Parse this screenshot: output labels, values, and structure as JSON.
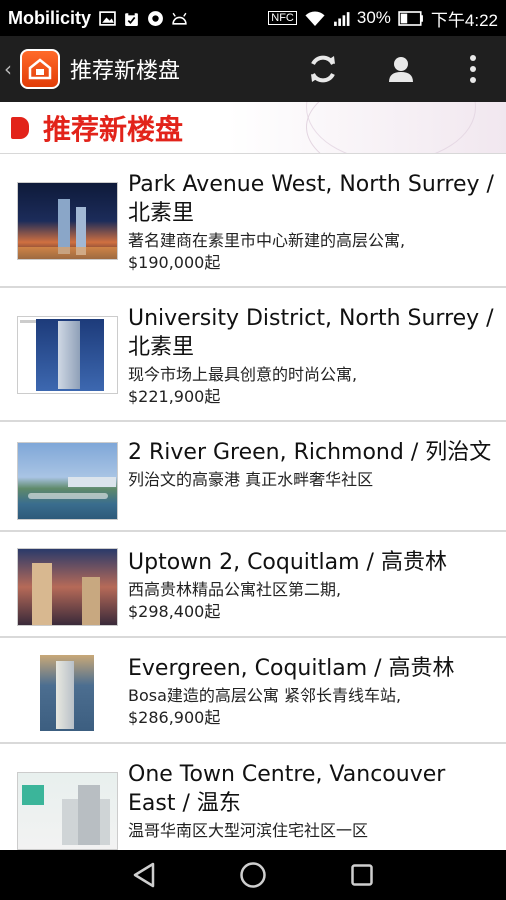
{
  "status_bar": {
    "carrier": "Mobilicity",
    "battery": "30%",
    "time": "下午4:22",
    "nfc": "NFC"
  },
  "action_bar": {
    "title": "推荐新楼盘",
    "icons": [
      "back-chevron",
      "app-logo",
      "refresh-icon",
      "profile-icon",
      "overflow-menu-icon"
    ]
  },
  "section": {
    "title": "推荐新楼盘"
  },
  "listings": [
    {
      "title": "Park Avenue West, North Surrey / 北素里",
      "desc": "著名建商在素里市中心新建的高层公寓,",
      "price": "$190,000起"
    },
    {
      "title": "University District, North Surrey / 北素里",
      "desc": "现今市场上最具创意的时尚公寓,",
      "price": "$221,900起"
    },
    {
      "title": "2 River Green, Richmond / 列治文",
      "desc": "列治文的高豪港 真正水畔奢华社区",
      "price": ""
    },
    {
      "title": "Uptown 2, Coquitlam / 高贵林",
      "desc": "西高贵林精品公寓社区第二期,",
      "price": "$298,400起"
    },
    {
      "title": "Evergreen, Coquitlam / 高贵林",
      "desc": "Bosa建造的高层公寓 紧邻长青线车站,",
      "price": "$286,900起"
    },
    {
      "title": "One Town Centre, Vancouver East / 温东",
      "desc": "温哥华南区大型河滨住宅社区一区",
      "price": ""
    }
  ]
}
